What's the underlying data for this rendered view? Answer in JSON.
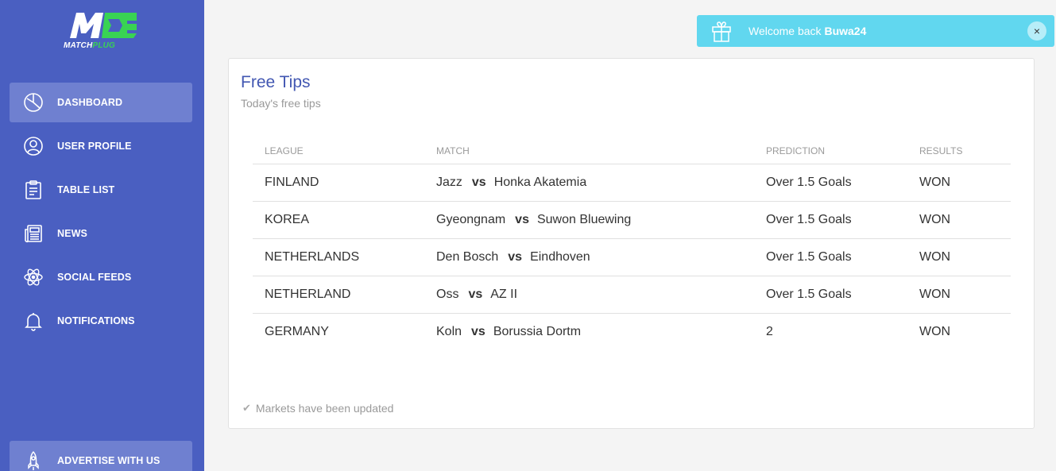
{
  "brand": {
    "logo_word": "MATCH",
    "logo_word_accent": "PLUG",
    "logo_mark": "M"
  },
  "sidebar": {
    "items": [
      {
        "label": "DASHBOARD",
        "icon": "pie-chart-icon",
        "active": true
      },
      {
        "label": "USER PROFILE",
        "icon": "user-icon",
        "active": false
      },
      {
        "label": "TABLE LIST",
        "icon": "clipboard-icon",
        "active": false
      },
      {
        "label": "NEWS",
        "icon": "newspaper-icon",
        "active": false
      },
      {
        "label": "SOCIAL FEEDS",
        "icon": "atom-icon",
        "active": false
      },
      {
        "label": "NOTIFICATIONS",
        "icon": "bell-icon",
        "active": false
      }
    ],
    "advertise": {
      "label": "ADVERTISE WITH US",
      "icon": "rocket-icon"
    }
  },
  "toast": {
    "prefix": "Welcome back",
    "username": "Buwa24",
    "close": "×",
    "icon": "gift-icon"
  },
  "card": {
    "title": "Free Tips",
    "subtitle": "Today's free tips",
    "headers": {
      "league": "LEAGUE",
      "match": "MATCH",
      "prediction": "PREDICTION",
      "results": "RESULTS"
    },
    "vs_label": "vs",
    "rows": [
      {
        "league": "FINLAND",
        "home": "Jazz",
        "away": "Honka Akatemia",
        "prediction": "Over 1.5 Goals",
        "result": "WON"
      },
      {
        "league": "KOREA",
        "home": "Gyeongnam",
        "away": "Suwon Bluewing",
        "prediction": "Over 1.5 Goals",
        "result": "WON"
      },
      {
        "league": "NETHERLANDS",
        "home": "Den Bosch",
        "away": "Eindhoven",
        "prediction": "Over 1.5 Goals",
        "result": "WON"
      },
      {
        "league": "NETHERLAND",
        "home": "Oss",
        "away": "AZ II",
        "prediction": "Over 1.5 Goals",
        "result": "WON"
      },
      {
        "league": "GERMANY",
        "home": "Koln",
        "away": "Borussia Dortm",
        "prediction": "2",
        "result": "WON"
      }
    ],
    "footer": "Markets have been updated",
    "footer_icon": "check-icon"
  },
  "colors": {
    "sidebar_bg": "#4a5fc1",
    "sidebar_active": "#6f80d0",
    "toast_bg": "#61d7ef",
    "title": "#4257b2",
    "logo_accent": "#39d353"
  }
}
